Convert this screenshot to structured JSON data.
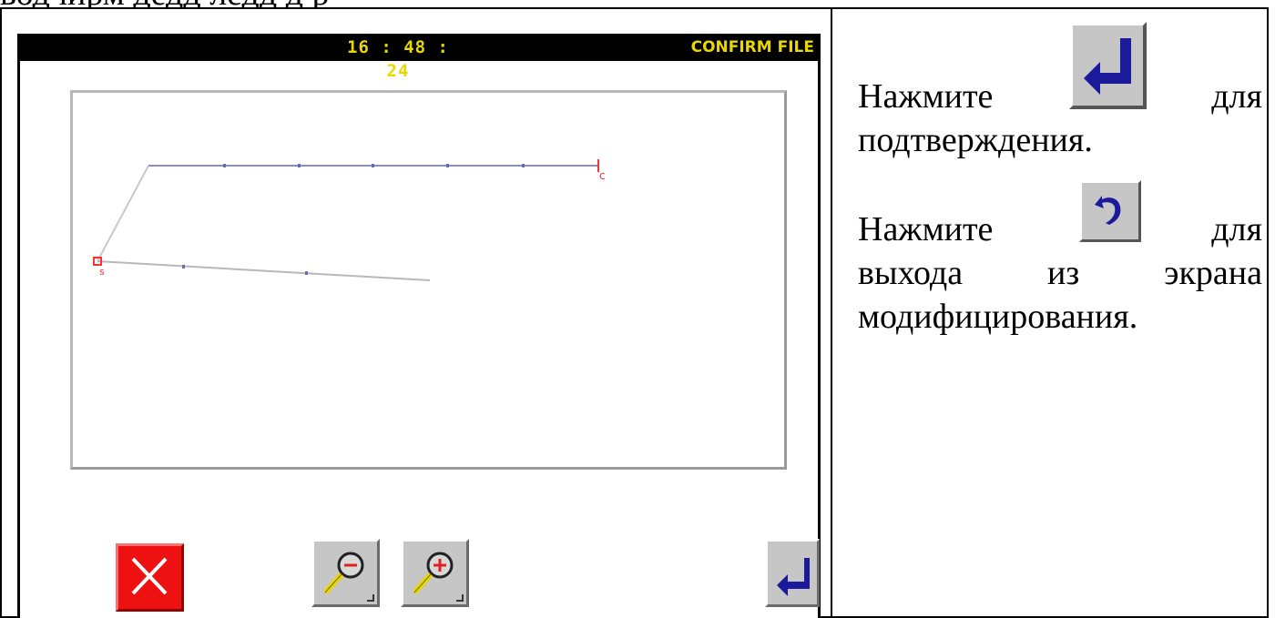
{
  "doc": {
    "top_text": "водчирм дедд    ледд   д р"
  },
  "screen": {
    "time": "16 : 48 : 24",
    "mode": "CONFIRM FILE"
  },
  "preview": {
    "point_labels": [
      "c",
      "s"
    ]
  },
  "buttons": {
    "cancel": "close-icon",
    "zoom_out": "zoom-out-icon",
    "zoom_in": "zoom-in-icon",
    "confirm": "enter-icon"
  },
  "instructions": {
    "confirm": {
      "press": "Нажмите",
      "for": "для",
      "rest": "подтверждения."
    },
    "exit": {
      "press": "Нажмите",
      "for": "для",
      "w1": "выхода",
      "w2": "из",
      "w3": "экрана",
      "rest": "модифицирования."
    }
  },
  "colors": {
    "titlebar_bg": "#000000",
    "titlebar_text": "#e8d800",
    "stitch_line_upper": "#8a8ad0",
    "stitch_line_lower": "#b0b0b0",
    "point_marker": "#ff3030",
    "button_face": "#c6c6c6",
    "cancel_red": "#ee1111",
    "enter_arrow": "#1a1a9a"
  }
}
